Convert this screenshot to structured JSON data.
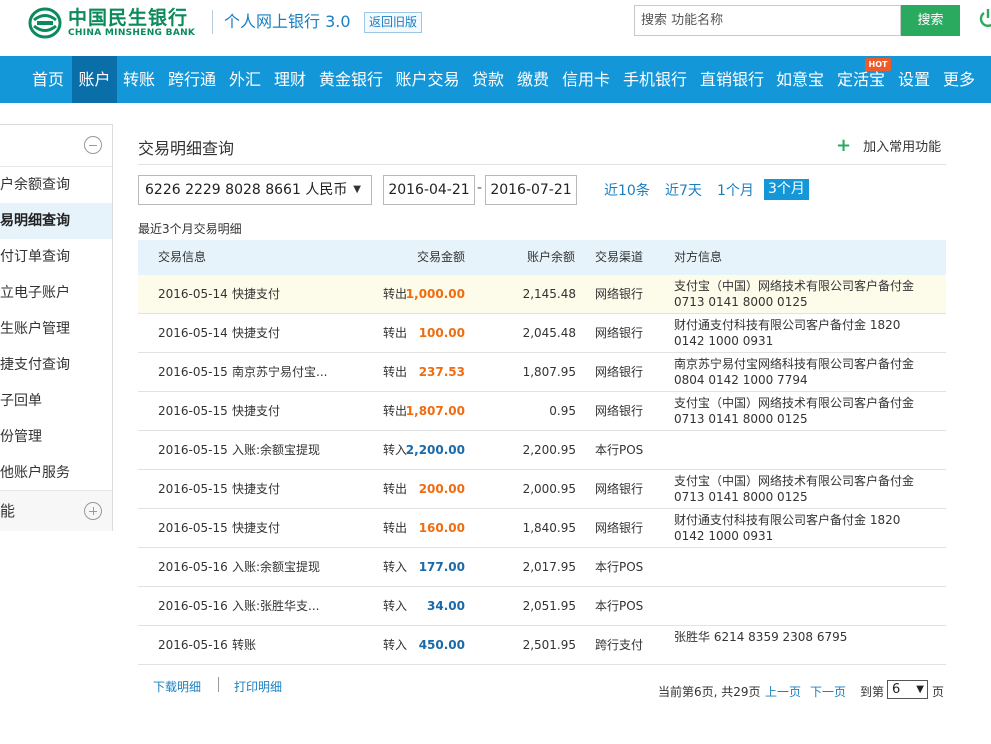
{
  "header": {
    "logo_cn": "中国民生银行",
    "logo_en": "CHINA MINSHENG BANK",
    "site_title": "个人网上银行 3.0",
    "old_version": "返回旧版",
    "search_placeholder": "搜索 功能名称",
    "search_button": "搜索",
    "icons": [
      "minsheng-logo-icon",
      "power-icon"
    ],
    "brand_color": "#0b8b5b"
  },
  "nav": {
    "items": [
      "首页",
      "账户",
      "转账",
      "跨行通",
      "外汇",
      "理财",
      "黄金银行",
      "账户交易",
      "贷款",
      "缴费",
      "信用卡",
      "手机银行",
      "直销银行",
      "如意宝",
      "定活宝",
      "设置",
      "更多"
    ],
    "active": "账户",
    "hot_badge": "HOT",
    "color": "#1497d9",
    "active_color": "#0a6fa8"
  },
  "sidebar": {
    "items": [
      "户余额查询",
      "易明细查询",
      "付订单查询",
      "立电子账户",
      "生账户管理",
      "捷支付查询",
      "子回单",
      "份管理",
      "他账户服务"
    ],
    "active_index": 1,
    "footer_label": "能",
    "icons": [
      "collapse-icon",
      "expand-icon"
    ]
  },
  "main": {
    "title": "交易明细查询",
    "add_favorite": "加入常用功能",
    "account": "6226 2229 8028 8661 人民币",
    "date_from": "2016-04-21",
    "date_sep": "-",
    "date_to": "2016-07-21",
    "quick_ranges": [
      "近10条",
      "近7天",
      "1个月",
      "3个月"
    ],
    "quick_active": "3个月",
    "recent_label": "最近3个月交易明细"
  },
  "table": {
    "headers": [
      "交易信息",
      "交易金额",
      "账户余额",
      "交易渠道",
      "对方信息"
    ],
    "rows": [
      {
        "date": "2016-05-14",
        "desc": "快捷支付",
        "dir": "转出",
        "amount": "1,000.00",
        "balance": "2,145.48",
        "channel": "网络银行",
        "counterparty": "支付宝（中国）网络技术有限公司客户备付金 0713 0141 8000 0125",
        "type": "out"
      },
      {
        "date": "2016-05-14",
        "desc": "快捷支付",
        "dir": "转出",
        "amount": "100.00",
        "balance": "2,045.48",
        "channel": "网络银行",
        "counterparty": "财付通支付科技有限公司客户备付金 1820 0142 1000 0931",
        "type": "out"
      },
      {
        "date": "2016-05-15",
        "desc": "南京苏宁易付宝...",
        "dir": "转出",
        "amount": "237.53",
        "balance": "1,807.95",
        "channel": "网络银行",
        "counterparty": "南京苏宁易付宝网络科技有限公司客户备付金 0804 0142 1000 7794",
        "type": "out"
      },
      {
        "date": "2016-05-15",
        "desc": "快捷支付",
        "dir": "转出",
        "amount": "1,807.00",
        "balance": "0.95",
        "channel": "网络银行",
        "counterparty": "支付宝（中国）网络技术有限公司客户备付金 0713 0141 8000 0125",
        "type": "out"
      },
      {
        "date": "2016-05-15",
        "desc": "入账:余额宝提现",
        "dir": "转入",
        "amount": "2,200.00",
        "balance": "2,200.95",
        "channel": "本行POS",
        "counterparty": "",
        "type": "in"
      },
      {
        "date": "2016-05-15",
        "desc": "快捷支付",
        "dir": "转出",
        "amount": "200.00",
        "balance": "2,000.95",
        "channel": "网络银行",
        "counterparty": "支付宝（中国）网络技术有限公司客户备付金 0713 0141 8000 0125",
        "type": "out"
      },
      {
        "date": "2016-05-15",
        "desc": "快捷支付",
        "dir": "转出",
        "amount": "160.00",
        "balance": "1,840.95",
        "channel": "网络银行",
        "counterparty": "财付通支付科技有限公司客户备付金 1820 0142 1000 0931",
        "type": "out"
      },
      {
        "date": "2016-05-16",
        "desc": "入账:余额宝提现",
        "dir": "转入",
        "amount": "177.00",
        "balance": "2,017.95",
        "channel": "本行POS",
        "counterparty": "",
        "type": "in"
      },
      {
        "date": "2016-05-16",
        "desc": "入账:张胜华支...",
        "dir": "转入",
        "amount": "34.00",
        "balance": "2,051.95",
        "channel": "本行POS",
        "counterparty": "",
        "type": "in"
      },
      {
        "date": "2016-05-16",
        "desc": "转账",
        "dir": "转入",
        "amount": "450.00",
        "balance": "2,501.95",
        "channel": "跨行支付",
        "counterparty": "张胜华 6214 8359 2308 6795",
        "type": "in"
      }
    ],
    "highlight_row": 0,
    "out_color": "#ef6c10",
    "in_color": "#1a69a8"
  },
  "footer": {
    "download": "下载明细",
    "print": "打印明细",
    "page_info": "当前第6页, 共29页",
    "prev": "上一页",
    "next": "下一页",
    "goto": "到第",
    "page_value": "6",
    "page_unit": "页"
  }
}
